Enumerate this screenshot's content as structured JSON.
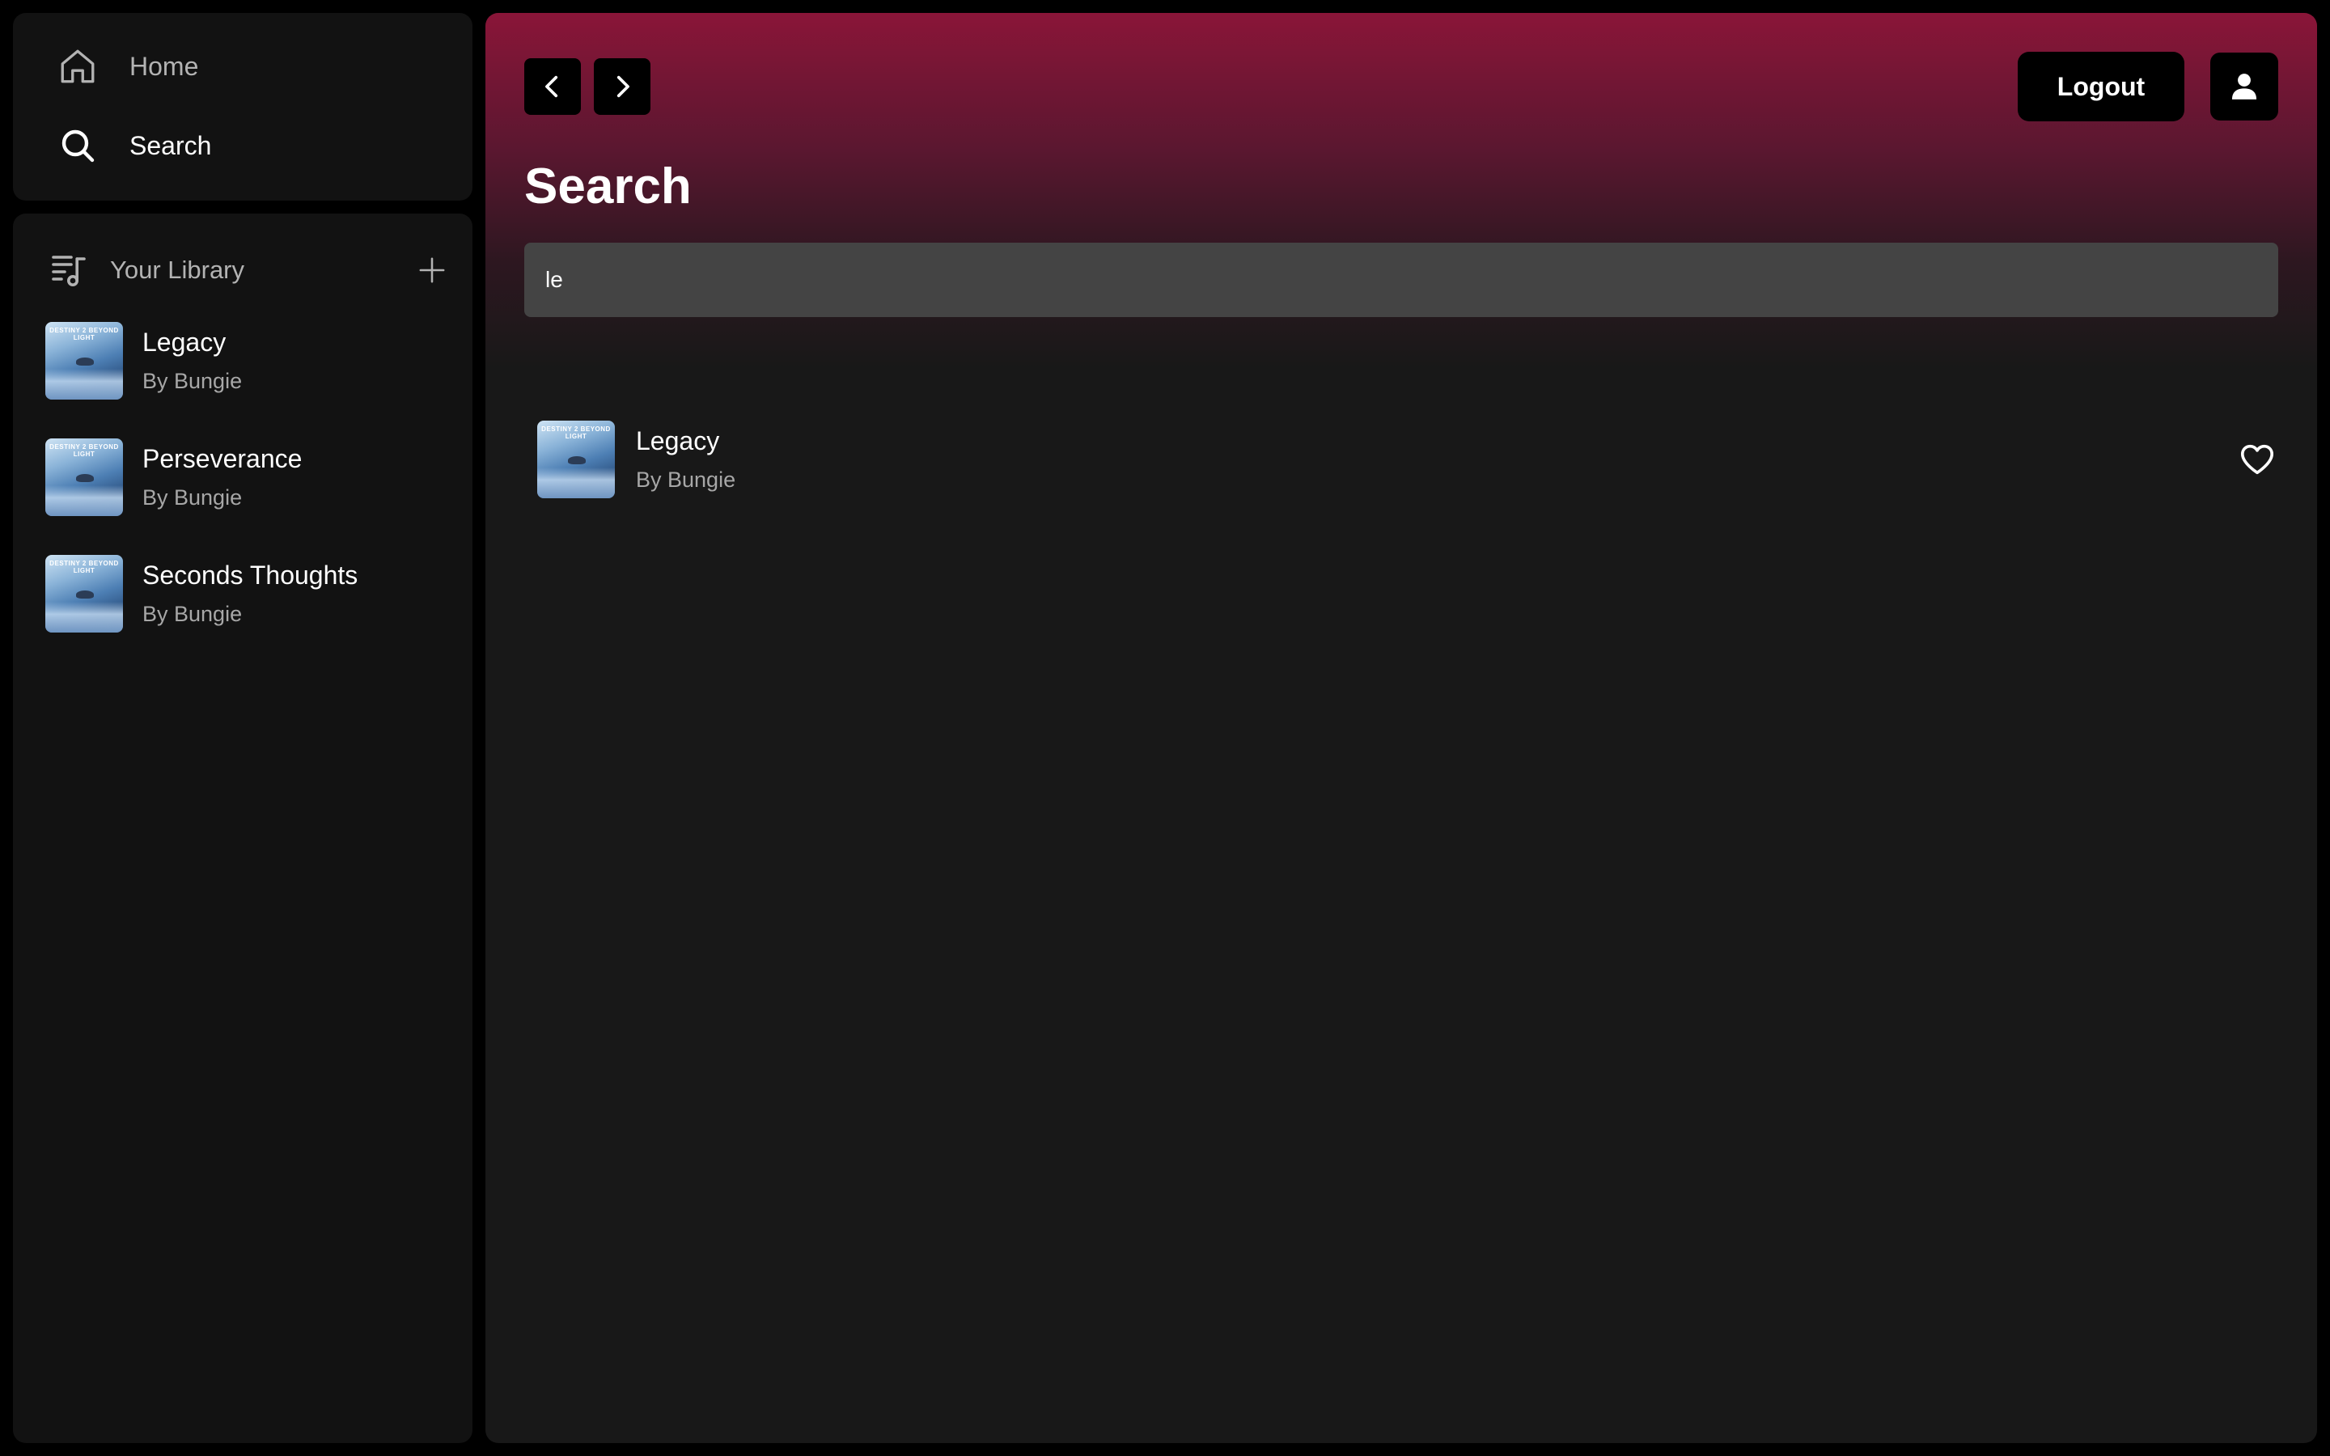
{
  "sidebar": {
    "nav": {
      "home_label": "Home",
      "search_label": "Search"
    },
    "library": {
      "title": "Your Library",
      "items": [
        {
          "title": "Legacy",
          "subtitle": "By Bungie",
          "cover_text": "DESTINY 2 BEYOND LIGHT"
        },
        {
          "title": "Perseverance",
          "subtitle": "By Bungie",
          "cover_text": "DESTINY 2 BEYOND LIGHT"
        },
        {
          "title": "Seconds Thoughts",
          "subtitle": "By Bungie",
          "cover_text": "DESTINY 2 BEYOND LIGHT"
        }
      ]
    }
  },
  "header": {
    "logout_label": "Logout"
  },
  "main": {
    "title": "Search",
    "search": {
      "value": "le"
    },
    "results": [
      {
        "title": "Legacy",
        "subtitle": "By Bungie",
        "cover_text": "DESTINY 2 BEYOND LIGHT"
      }
    ]
  },
  "icons": {
    "home": "home-icon",
    "search": "search-icon",
    "library": "library-icon",
    "add": "plus-icon",
    "back": "chevron-left-icon",
    "forward": "chevron-right-icon",
    "profile": "user-icon",
    "like": "heart-icon"
  },
  "colors": {
    "accent_gradient_top": "#8a1538",
    "panel_background": "#121212",
    "main_background": "#181818",
    "input_background": "#444444",
    "muted_text": "#b3b3b3"
  }
}
